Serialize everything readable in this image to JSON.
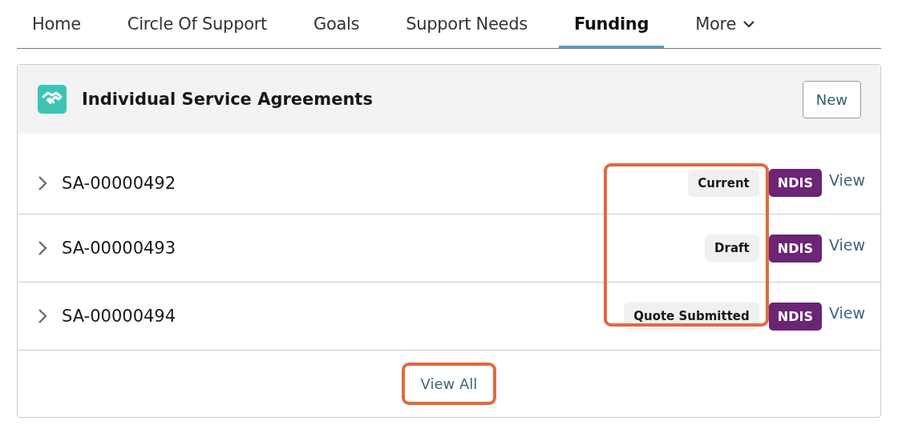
{
  "tabs": [
    {
      "label": "Home",
      "selected": false
    },
    {
      "label": "Circle Of Support",
      "selected": false
    },
    {
      "label": "Goals",
      "selected": false
    },
    {
      "label": "Support Needs",
      "selected": false
    },
    {
      "label": "Funding",
      "selected": true
    },
    {
      "label": "More",
      "selected": false,
      "kind": "menu"
    }
  ],
  "card": {
    "title": "Individual Service Agreements",
    "new_button": "New",
    "status_highlighted": true,
    "rows": [
      {
        "id": "SA-00000492",
        "status": "Current",
        "program": "NDIS",
        "action": "View"
      },
      {
        "id": "SA-00000493",
        "status": "Draft",
        "program": "NDIS",
        "action": "View"
      },
      {
        "id": "SA-00000494",
        "status": "Quote Submitted",
        "program": "NDIS",
        "action": "View"
      }
    ],
    "view_all": {
      "label": "View All",
      "highlighted": true
    }
  }
}
